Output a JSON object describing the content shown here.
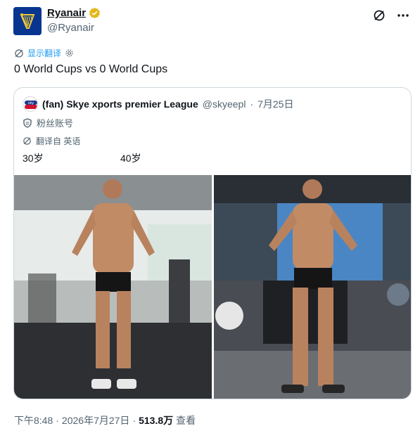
{
  "author": {
    "display_name": "Ryanair",
    "handle": "@Ryanair",
    "brand_color": "#073590",
    "avatar_icon": "ryanair-harp-logo-icon"
  },
  "header_actions": {
    "grok_icon": "grok-icon",
    "more_icon": "more-dots-icon"
  },
  "translate": {
    "label": "显示翻译"
  },
  "tweet": {
    "text": "0 World Cups vs 0 World Cups"
  },
  "quote": {
    "name": "(fan) Skye xports premier League",
    "handle": "@skyeepl",
    "separator": "·",
    "date": "7月25日",
    "fan_label": "粉丝账号",
    "translated_from": "翻译自 英语",
    "age_left": "30岁",
    "age_right": "40岁"
  },
  "footer": {
    "time": "下午8:48",
    "separator": "·",
    "date": "2026年7月27日",
    "separator2": "·",
    "views_count": "513.8万",
    "views_label": "查看"
  },
  "colors": {
    "link": "#1d9bf0",
    "muted": "#536471",
    "verified_gold": "#e2b719"
  }
}
